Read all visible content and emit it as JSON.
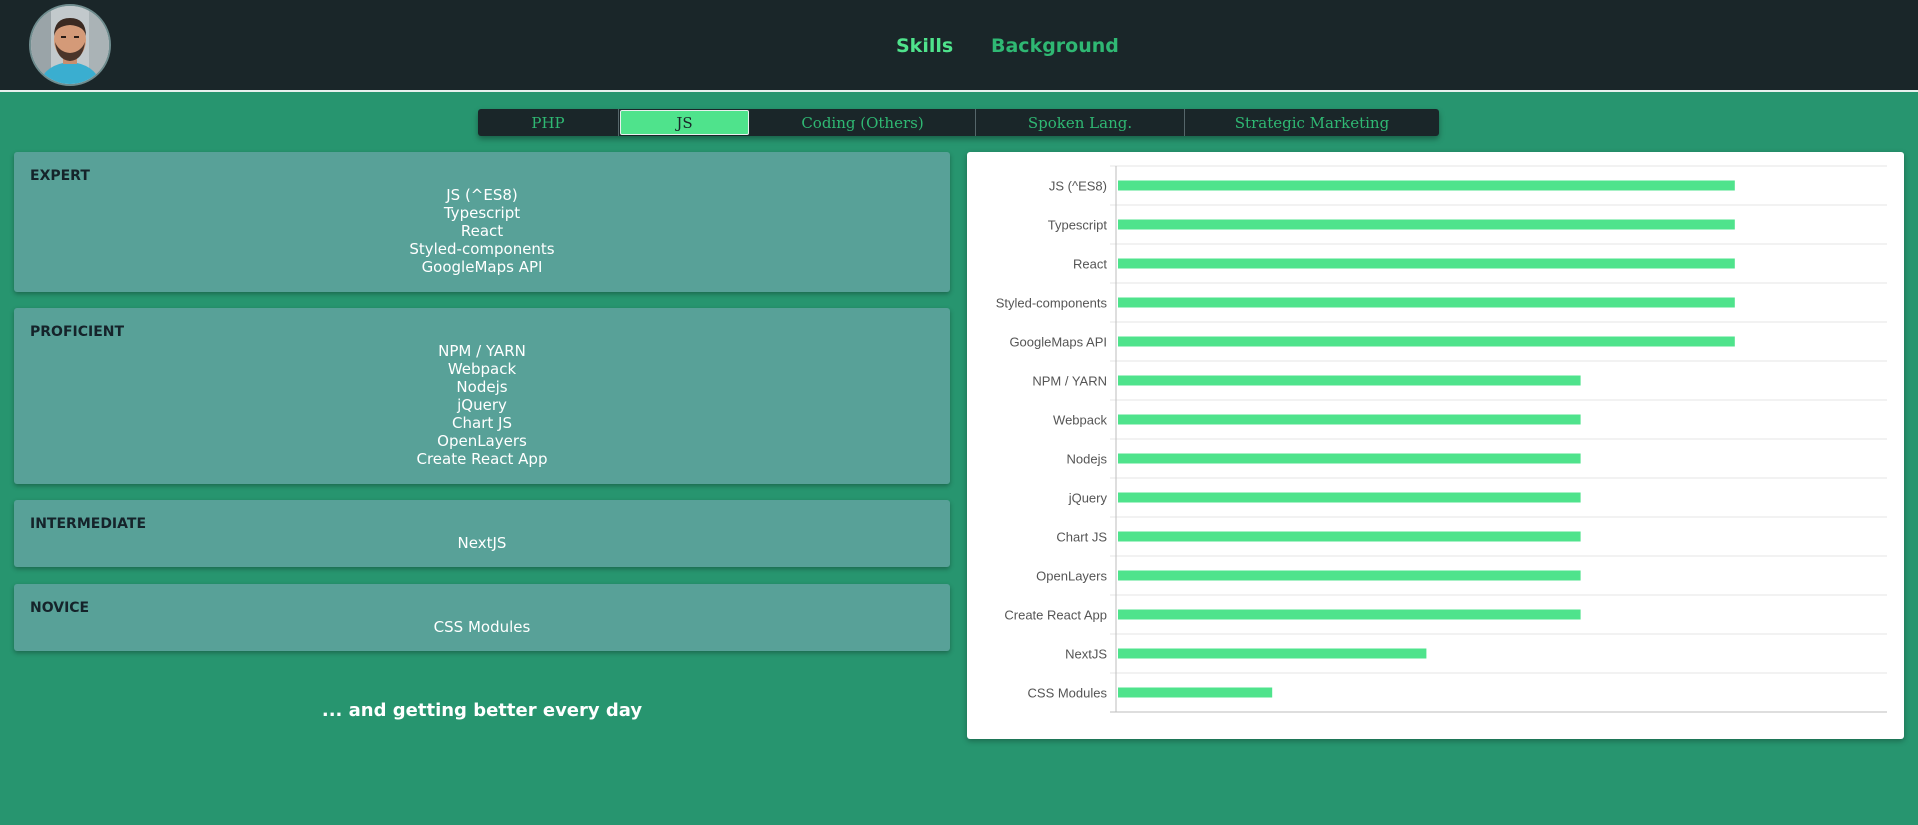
{
  "nav": {
    "skills_label": "Skills",
    "background_label": "Background"
  },
  "tabs": [
    {
      "label": "PHP",
      "active": false
    },
    {
      "label": "JS",
      "active": true
    },
    {
      "label": "Coding (Others)",
      "active": false
    },
    {
      "label": "Spoken Lang.",
      "active": false
    },
    {
      "label": "Strategic Marketing",
      "active": false
    }
  ],
  "levels": [
    {
      "title": "EXPERT",
      "items": [
        "JS (^ES8)",
        "Typescript",
        "React",
        "Styled-components",
        "GoogleMaps API"
      ]
    },
    {
      "title": "PROFICIENT",
      "items": [
        "NPM / YARN",
        "Webpack",
        "Nodejs",
        "jQuery",
        "Chart JS",
        "OpenLayers",
        "Create React App"
      ]
    },
    {
      "title": "INTERMEDIATE",
      "items": [
        "NextJS"
      ]
    },
    {
      "title": "NOVICE",
      "items": [
        "CSS Modules"
      ]
    }
  ],
  "tagline": "... and getting better every day",
  "colors": {
    "accent": "#4fe38c",
    "background": "#27956f",
    "header": "#1a2629",
    "panel": "#58a198"
  },
  "chart_data": {
    "type": "bar",
    "orientation": "horizontal",
    "categories": [
      "JS (^ES8)",
      "Typescript",
      "React",
      "Styled-components",
      "GoogleMaps API",
      "NPM / YARN",
      "Webpack",
      "Nodejs",
      "jQuery",
      "Chart JS",
      "OpenLayers",
      "Create React App",
      "NextJS",
      "CSS Modules"
    ],
    "values": [
      4,
      4,
      4,
      4,
      4,
      3,
      3,
      3,
      3,
      3,
      3,
      3,
      2,
      1
    ],
    "xlim": [
      0,
      5
    ],
    "grid": true,
    "color": "#4fe38c"
  }
}
